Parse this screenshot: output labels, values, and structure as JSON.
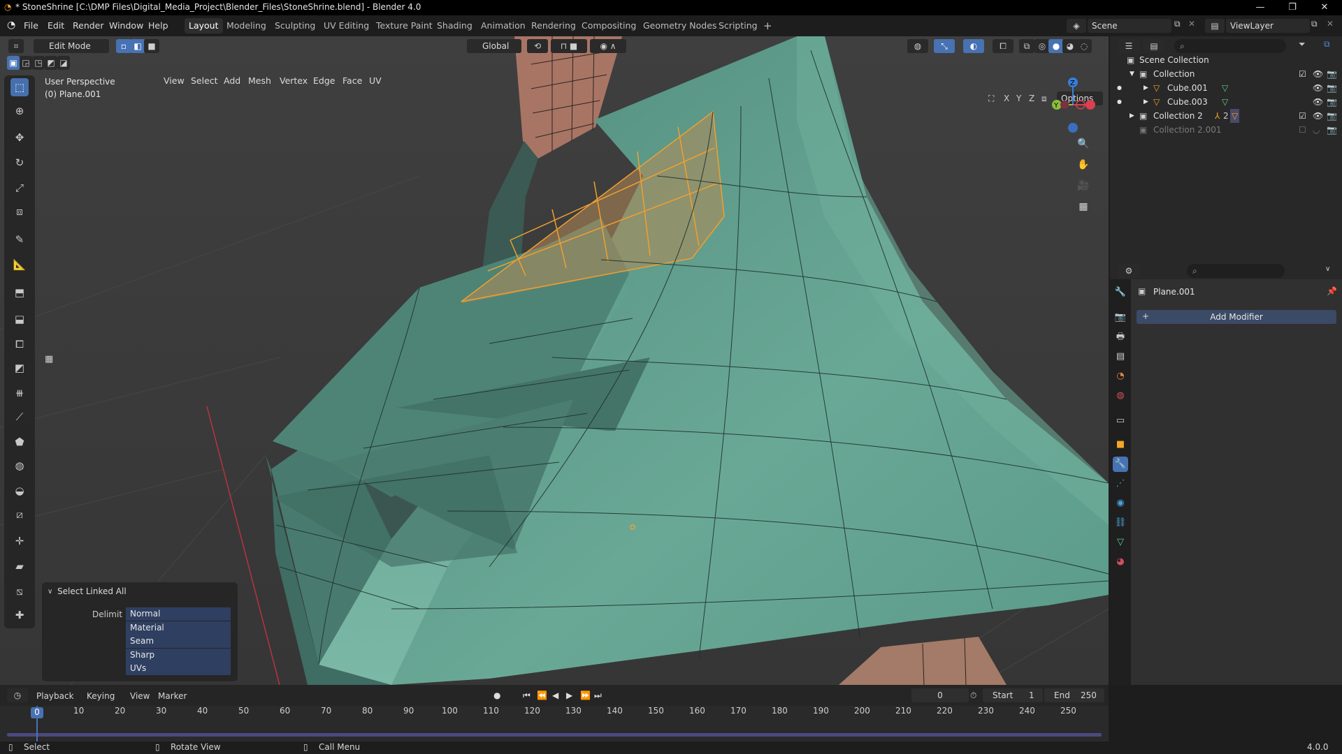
{
  "window": {
    "title": "* StoneShrine [C:\\DMP Files\\Digital_Media_Project\\Blender_Files\\StoneShrine.blend] - Blender 4.0",
    "minimize": "—",
    "maximize": "❐",
    "close": "✕"
  },
  "menu": {
    "file": "File",
    "edit": "Edit",
    "render": "Render",
    "window": "Window",
    "help": "Help"
  },
  "workspaces": [
    "Layout",
    "Modeling",
    "Sculpting",
    "UV Editing",
    "Texture Paint",
    "Shading",
    "Animation",
    "Rendering",
    "Compositing",
    "Geometry Nodes",
    "Scripting"
  ],
  "workspace_add": "+",
  "scene": {
    "label": "Scene",
    "view_layer": "ViewLayer"
  },
  "viewport_header": {
    "mode": "Edit Mode",
    "view": "View",
    "select": "Select",
    "add": "Add",
    "mesh": "Mesh",
    "vertex": "Vertex",
    "edge": "Edge",
    "face": "Face",
    "uv": "UV",
    "transform_orientation": "Global",
    "options": "Options",
    "x": "X",
    "y": "Y",
    "z": "Z"
  },
  "viewport": {
    "perspective": "User Perspective",
    "object": "(0) Plane.001"
  },
  "redo_panel": {
    "title": "Select Linked All",
    "delimit_label": "Delimit",
    "options": [
      "Normal",
      "Material",
      "Seam",
      "Sharp",
      "UVs"
    ]
  },
  "outliner": {
    "scene_collection": "Scene Collection",
    "collection": "Collection",
    "cube1": "Cube.001",
    "cube3": "Cube.003",
    "collection2": "Collection 2",
    "collection2_count": "2",
    "collection2001": "Collection 2.001"
  },
  "properties": {
    "object": "Plane.001",
    "add_modifier": "Add Modifier"
  },
  "timeline": {
    "playback": "Playback",
    "keying": "Keying",
    "view": "View",
    "marker": "Marker",
    "current_frame": "0",
    "start_label": "Start",
    "start": "1",
    "end_label": "End",
    "end": "250",
    "ticks": [
      "0",
      "10",
      "20",
      "30",
      "40",
      "50",
      "60",
      "70",
      "80",
      "90",
      "100",
      "110",
      "120",
      "130",
      "140",
      "150",
      "160",
      "170",
      "180",
      "190",
      "200",
      "210",
      "220",
      "230",
      "240",
      "250"
    ]
  },
  "status": {
    "select": "Select",
    "rotate": "Rotate View",
    "menu": "Call Menu",
    "version": "4.0.0"
  },
  "colors": {
    "accent": "#4772b3",
    "mesh": "#5e9c8c",
    "selection": "#f0a030",
    "gizmo_x": "#d94050",
    "gizmo_y": "#8cbf3a",
    "gizmo_z": "#3a7dd9"
  }
}
